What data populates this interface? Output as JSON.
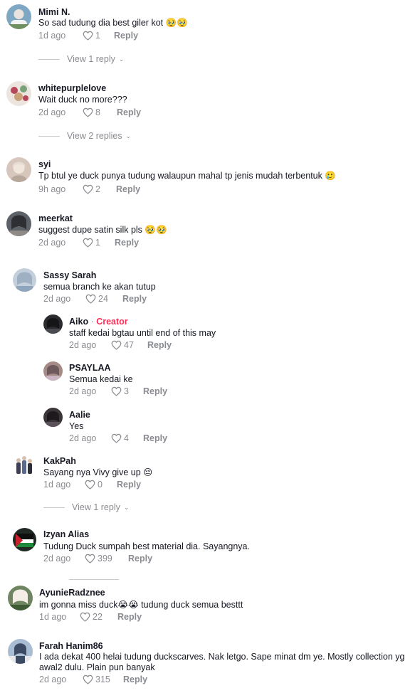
{
  "comments": [
    {
      "username": "Mimi N.",
      "text": "So sad tudung dia best giler kot 🥹🥹",
      "time": "1d ago",
      "likes": "1",
      "reply": "Reply",
      "view_replies": "View 1 reply",
      "avatar_color": "#7ea7c4"
    },
    {
      "username": "whitepurplelove",
      "text": "Wait duck no more???",
      "time": "2d ago",
      "likes": "8",
      "reply": "Reply",
      "view_replies": "View 2 replies",
      "avatar_color": "#e9dfd8"
    },
    {
      "username": "syi",
      "text": "Tp btul ye duck punya tudung walaupun mahal tp jenis mudah terbentuk 🥲",
      "time": "9h ago",
      "likes": "2",
      "reply": "Reply",
      "avatar_color": "#d9c4b8"
    },
    {
      "username": "meerkat",
      "text": "suggest dupe satin silk pls 🥹🥹",
      "time": "2d ago",
      "likes": "1",
      "reply": "Reply",
      "avatar_color": "#5b5f66"
    },
    {
      "username": "Sassy Sarah",
      "text": "semua branch ke akan tutup",
      "time": "2d ago",
      "likes": "24",
      "reply": "Reply",
      "avatar_color": "#b9c7d6"
    },
    {
      "username": "Aiko",
      "creator": "Creator",
      "text": "staff kedai bgtau until end of this may",
      "time": "2d ago",
      "likes": "47",
      "reply": "Reply",
      "avatar_color": "#2d2a2e"
    },
    {
      "username": "PSAYLAA",
      "text": "Semua kedai ke",
      "time": "2d ago",
      "likes": "3",
      "reply": "Reply",
      "avatar_color": "#a88a86"
    },
    {
      "username": "Aalie",
      "text": "Yes",
      "time": "2d ago",
      "likes": "4",
      "reply": "Reply",
      "avatar_color": "#3a3338"
    },
    {
      "username": "KakPah",
      "text": "Sayang nya Vivy give up 😔",
      "time": "1d ago",
      "likes": "0",
      "reply": "Reply",
      "view_replies": "View 1 reply",
      "avatar_color": "#dfe3ea"
    },
    {
      "username": "Izyan Alias",
      "text": "Tudung Duck sumpah best material dia. Sayangnya.",
      "time": "2d ago",
      "likes": "399",
      "reply": "Reply",
      "avatar_color": "#1f2a22"
    },
    {
      "username": "AyunieRadznee",
      "text": "im gonna miss duck😭😭 tudung duck semua besttt",
      "time": "1d ago",
      "likes": "22",
      "reply": "Reply",
      "avatar_color": "#6a7f5a"
    },
    {
      "username": "Farah Hanim86",
      "text": "I ada dekat 400 helai tudung duckscarves. Nak letgo. Sape minat dm ye. Mostly collection yg awal2 dulu. Plain pun banyak",
      "time": "2d ago",
      "likes": "315",
      "reply": "Reply",
      "avatar_color": "#9fb3c9"
    }
  ]
}
